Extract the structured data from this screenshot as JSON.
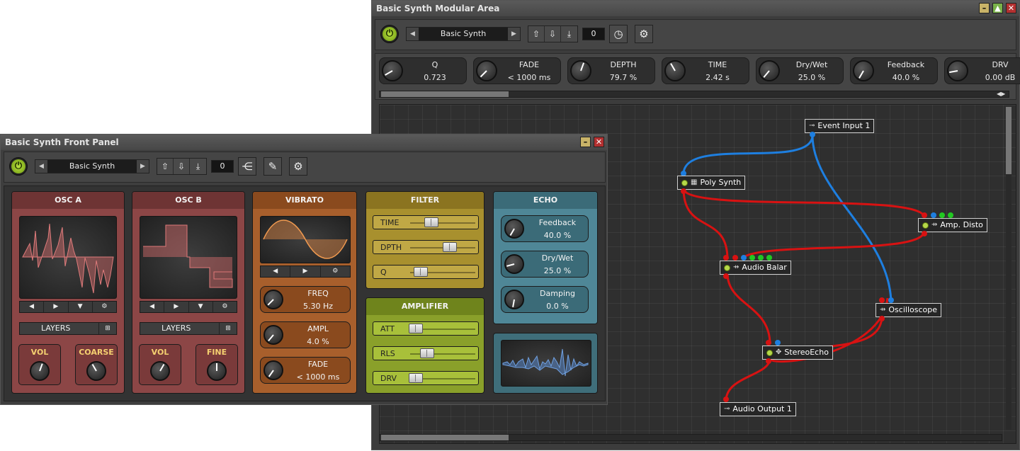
{
  "modular": {
    "title": "Basic Synth Modular Area",
    "preset": "Basic Synth",
    "preset_number": "0",
    "knobs": [
      {
        "name": "Q",
        "value": "0.723"
      },
      {
        "name": "FADE",
        "value": "< 1000 ms"
      },
      {
        "name": "DEPTH",
        "value": "79.7 %"
      },
      {
        "name": "TIME",
        "value": "2.42 s"
      },
      {
        "name": "Dry/Wet",
        "value": "25.0 %"
      },
      {
        "name": "Feedback",
        "value": "40.0 %"
      },
      {
        "name": "DRV",
        "value": "0.00 dB"
      }
    ],
    "nodes": {
      "event_input": "Event Input 1",
      "poly_synth": "Poly Synth",
      "amp_disto": "Amp. Disto",
      "audio_balance": "Audio Balar",
      "oscilloscope": "Oscilloscope",
      "stereo_echo": "StereoEcho",
      "audio_output": "Audio Output 1"
    }
  },
  "front": {
    "title": "Basic Synth Front Panel",
    "preset": "Basic Synth",
    "preset_number": "0",
    "osc_a": {
      "title": "OSC A",
      "layers": "LAYERS",
      "k1": "VOL",
      "k2": "COARSE"
    },
    "osc_b": {
      "title": "OSC B",
      "layers": "LAYERS",
      "k1": "VOL",
      "k2": "FINE"
    },
    "vibrato": {
      "title": "VIBRATO",
      "knobs": [
        {
          "name": "FREQ",
          "value": "5.30 Hz"
        },
        {
          "name": "AMPL",
          "value": "4.0 %"
        },
        {
          "name": "FADE",
          "value": "< 1000 ms"
        }
      ]
    },
    "filter": {
      "title": "FILTER",
      "sliders": [
        "TIME",
        "DPTH",
        "Q"
      ]
    },
    "amplifier": {
      "title": "AMPLIFIER",
      "sliders": [
        "ATT",
        "RLS",
        "DRV"
      ]
    },
    "echo": {
      "title": "ECHO",
      "knobs": [
        {
          "name": "Feedback",
          "value": "40.0 %"
        },
        {
          "name": "Dry/Wet",
          "value": "25.0 %"
        },
        {
          "name": "Damping",
          "value": "0.0 %"
        }
      ]
    }
  },
  "colors": {
    "osc": "#8c4646",
    "vibrato": "#a85f2c",
    "filter": "#a8902e",
    "amplifier": "#8aa02a",
    "echo": "#4f8797",
    "power": "#9fcc2a",
    "wire_audio": "#d81212",
    "wire_event": "#1e7fe0"
  }
}
